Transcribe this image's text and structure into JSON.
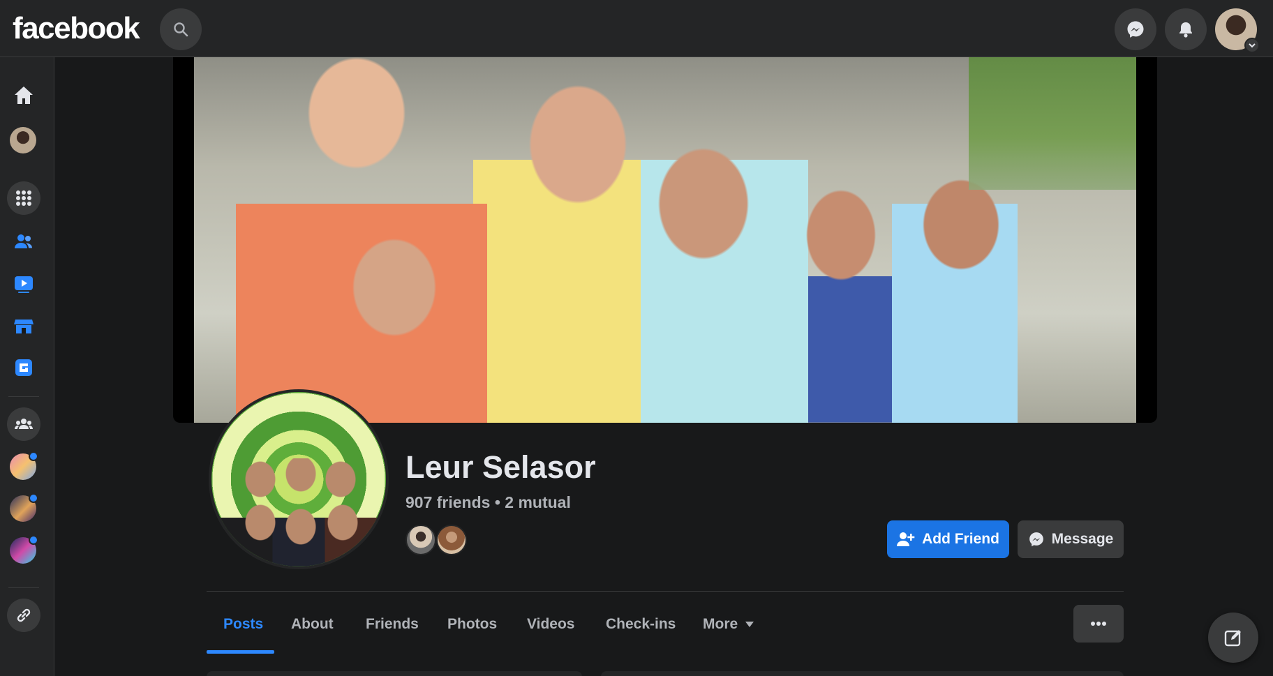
{
  "header": {
    "logo": "facebook",
    "icons": [
      "search-icon",
      "messenger-icon",
      "bell-icon",
      "account-avatar"
    ]
  },
  "leftrail": {
    "items": [
      "home-icon",
      "profile-avatar",
      "menu-grid-icon",
      "friends-icon",
      "watch-icon",
      "marketplace-icon",
      "gaming-icon",
      "groups-icon",
      "group-shortcut-1",
      "group-shortcut-2",
      "group-shortcut-3",
      "link-icon"
    ]
  },
  "profile": {
    "name": "Leur Selasor",
    "friends_line": "907 friends • 2 mutual",
    "add_friend_label": "Add Friend",
    "message_label": "Message"
  },
  "tabs": [
    {
      "label": "Posts",
      "active": true
    },
    {
      "label": "About",
      "active": false
    },
    {
      "label": "Friends",
      "active": false
    },
    {
      "label": "Photos",
      "active": false
    },
    {
      "label": "Videos",
      "active": false
    },
    {
      "label": "Check-ins",
      "active": false
    },
    {
      "label": "More",
      "active": false
    }
  ],
  "colors": {
    "background": "#18191a",
    "surface": "#242526",
    "button": "#3a3b3c",
    "accent": "#2d88ff",
    "primary_button": "#1b74e4"
  }
}
